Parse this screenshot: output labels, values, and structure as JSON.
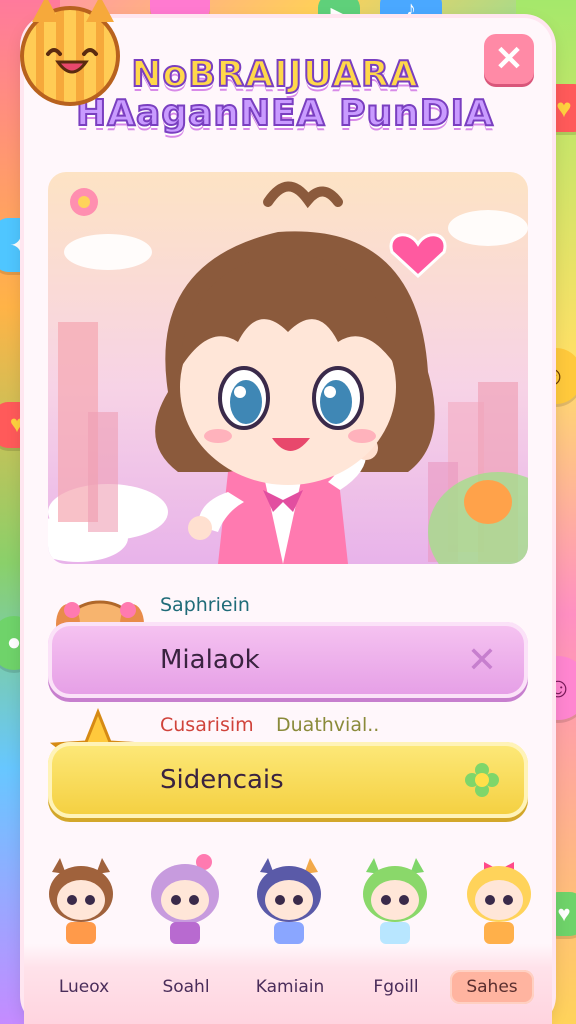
{
  "app": {
    "title_line1": "NoBRAIJUARA",
    "title_line2": "HAaganNEA PunDIA"
  },
  "close_label": "✕",
  "field1": {
    "label": "Saphriein",
    "value": "Mialaok"
  },
  "field2": {
    "label_a": "Cusarisim",
    "label_b": "Duathvial..",
    "value": "Sidencais"
  },
  "tabs": [
    {
      "label": "Lueox",
      "active": false
    },
    {
      "label": "Soahl",
      "active": false
    },
    {
      "label": "Kamiain",
      "active": false
    },
    {
      "label": "Fgoill",
      "active": false
    },
    {
      "label": "Sahes",
      "active": true
    }
  ],
  "colors": {
    "accent_pink": "#e59ee6",
    "accent_yellow": "#f4cf3f",
    "close_bg": "#ff8aa6",
    "active_tab": "#ffb4a0"
  },
  "icons": {
    "logo": "cat-face-icon",
    "close": "close-icon",
    "field1_avatar": "puppy-avatar-icon",
    "field1_action": "clear-x-icon",
    "field2_avatar": "star-face-icon",
    "field2_action": "flower-icon"
  }
}
